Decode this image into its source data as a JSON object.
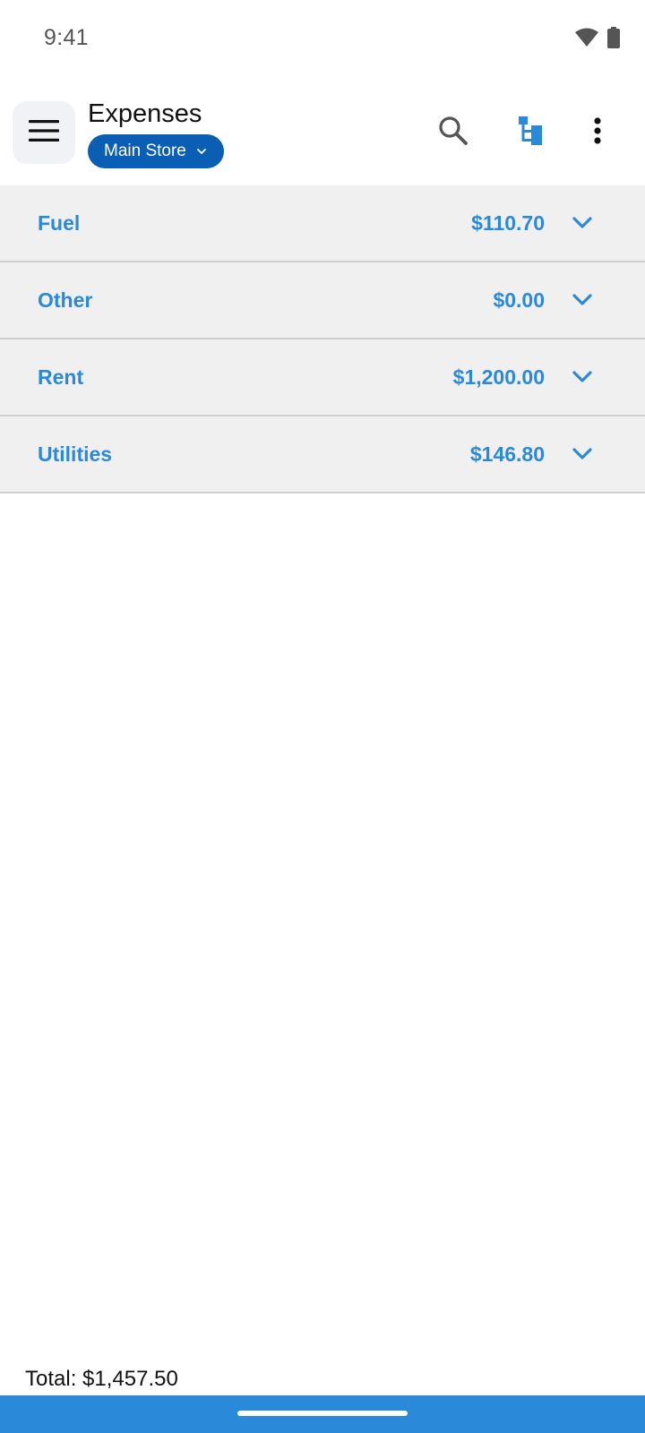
{
  "status_bar": {
    "time": "9:41",
    "icons": [
      "wifi-icon",
      "battery-icon"
    ]
  },
  "app_bar": {
    "title": "Expenses",
    "store_selector": "Main Store",
    "actions": [
      "search-icon",
      "hierarchy-icon",
      "more-vert-icon"
    ]
  },
  "expense_categories": [
    {
      "label": "Fuel",
      "amount": "$110.70"
    },
    {
      "label": "Other",
      "amount": "$0.00"
    },
    {
      "label": "Rent",
      "amount": "$1,200.00"
    },
    {
      "label": "Utilities",
      "amount": "$146.80"
    }
  ],
  "footer": {
    "total": "Total: $1,457.50"
  },
  "colors": {
    "accent": "#2A89D9",
    "chip": "#0A5FB4",
    "row_bg": "#F0F0F1",
    "nav_bar": "#2A89D9"
  }
}
